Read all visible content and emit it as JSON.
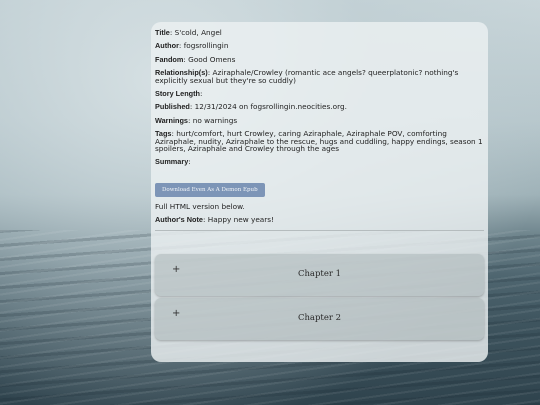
{
  "work": {
    "title_label": "Title",
    "title": "S'cold, Angel",
    "author_label": "Author",
    "author": "fogsrollingin",
    "fandom_label": "Fandom",
    "fandom": "Good Omens",
    "relationship_label": "Relationship(s)",
    "relationship": "Aziraphale/Crowley (romantic ace angels? queerplatonic? nothing's explicitly sexual but they're so cuddly)",
    "story_length_label": "Story Length",
    "story_length": "",
    "published_label": "Published",
    "published": "12/31/2024 on fogsrollingin.neocities.org.",
    "warnings_label": "Warnings",
    "warnings": "no warnings",
    "tags_label": "Tags",
    "tags": "hurt/comfort, hurt Crowley, caring Aziraphale, Aziraphale POV, comforting Aziraphale, nudity, Aziraphale to the rescue, hugs and cuddling, happy endings, season 1 spoilers, Aziraphale and Crowley through the ages",
    "summary_label": "Summary",
    "summary": "",
    "download_button": "Download Even As A Demon Epub",
    "full_html_note": "Full HTML version below.",
    "authors_note_label": "Author's Note",
    "authors_note": "Happy new years!"
  },
  "chapters": [
    {
      "label": "Chapter 1",
      "expand_icon": "+"
    },
    {
      "label": "Chapter 2",
      "expand_icon": "+"
    }
  ],
  "colors": {
    "download_button_bg": "#7d95b7",
    "card_bg": "#ecf0f1"
  }
}
